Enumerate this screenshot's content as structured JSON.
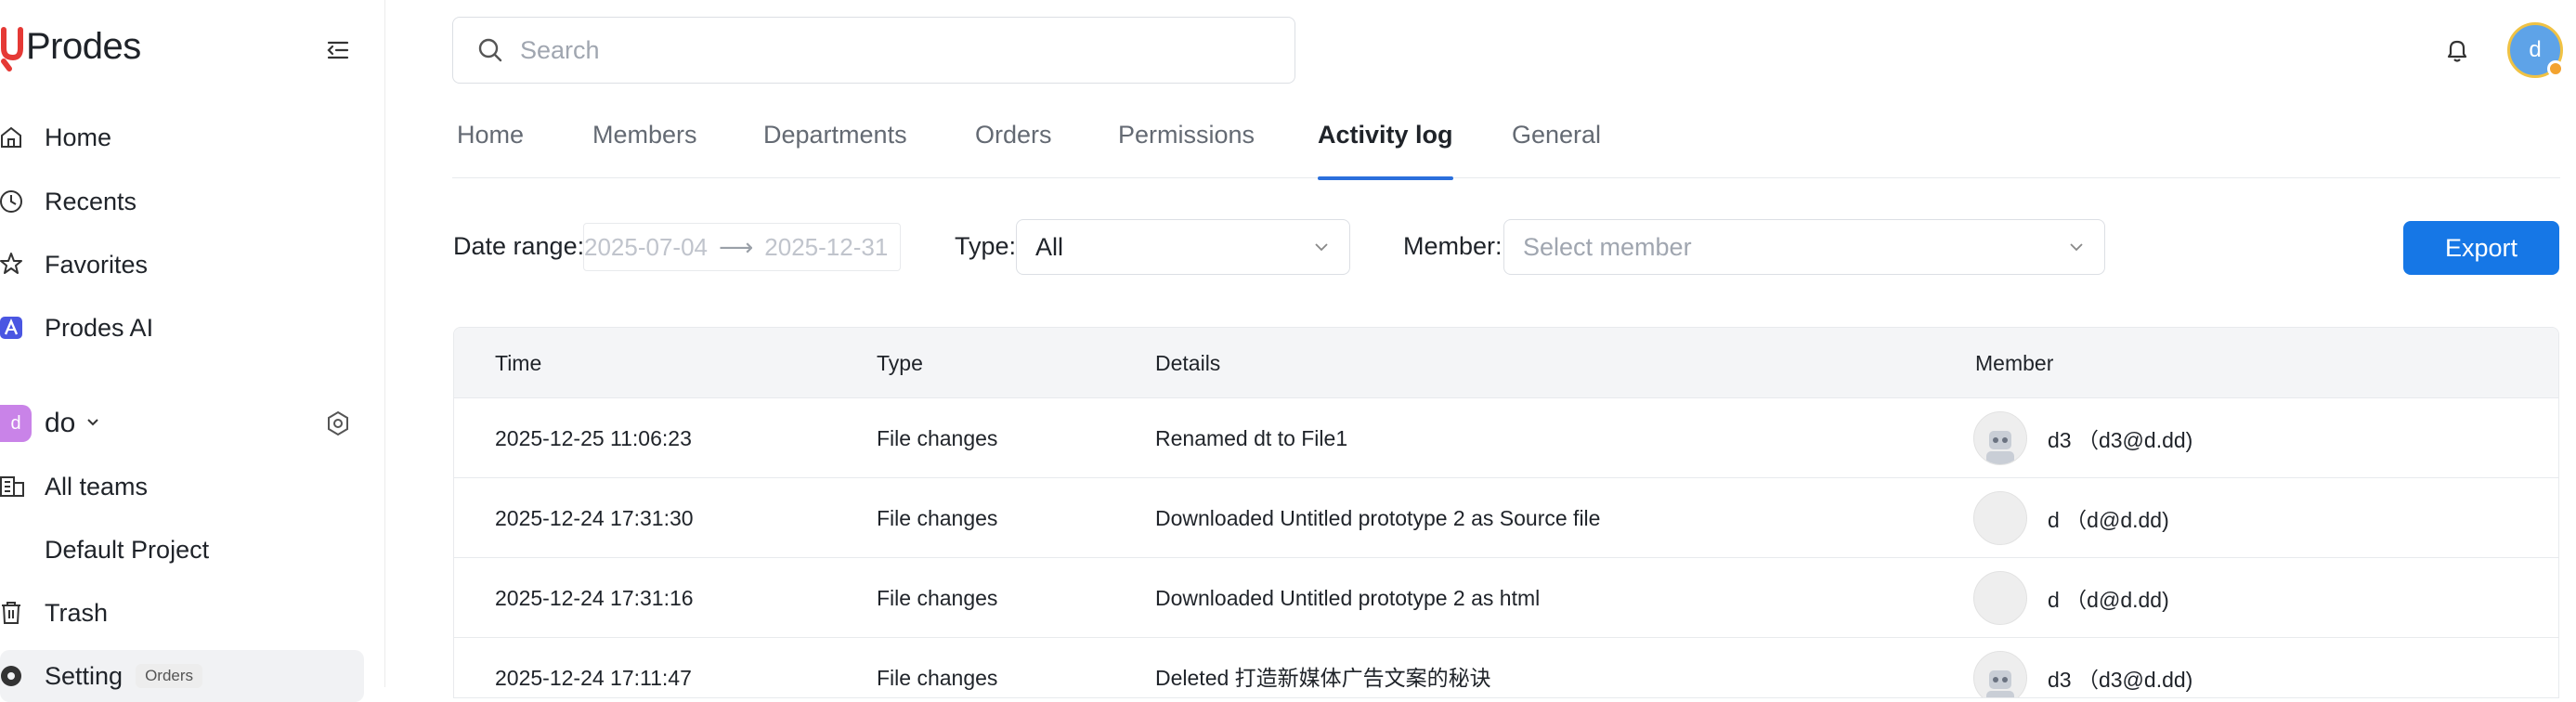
{
  "brand": {
    "name": "Prodes",
    "accent": "#e53935"
  },
  "sidebar": {
    "items": [
      {
        "label": "Home",
        "icon": "home-icon"
      },
      {
        "label": "Recents",
        "icon": "clock-icon"
      },
      {
        "label": "Favorites",
        "icon": "star-icon"
      },
      {
        "label": "Prodes AI",
        "icon": "ai-icon"
      }
    ],
    "team": {
      "initial": "d",
      "name": "do"
    },
    "team_items": [
      {
        "label": "All teams",
        "icon": "teams-icon"
      },
      {
        "label": "Default Project",
        "icon": ""
      },
      {
        "label": "Trash",
        "icon": "trash-icon"
      },
      {
        "label": "Setting",
        "icon": "settings-icon",
        "badge": "Orders"
      }
    ]
  },
  "search": {
    "placeholder": "Search"
  },
  "user": {
    "initial": "d"
  },
  "tabs": [
    "Home",
    "Members",
    "Departments",
    "Orders",
    "Permissions",
    "Activity log",
    "General"
  ],
  "active_tab": "Activity log",
  "filters": {
    "date_label": "Date range:",
    "date_start": "2025-07-04",
    "date_end": "2025-12-31",
    "type_label": "Type:",
    "type_value": "All",
    "member_label": "Member:",
    "member_placeholder": "Select member",
    "export_label": "Export"
  },
  "table": {
    "headers": [
      "Time",
      "Type",
      "Details",
      "Member"
    ],
    "rows": [
      {
        "time": "2025-12-25 11:06:23",
        "type": "File changes",
        "details": "Renamed dt to File1",
        "member": "d3 （d3@d.dd)",
        "avatar": "robot"
      },
      {
        "time": "2025-12-24 17:31:30",
        "type": "File changes",
        "details": "Downloaded Untitled prototype 2 as Source file",
        "member": "d （d@d.dd)",
        "avatar": "blank"
      },
      {
        "time": "2025-12-24 17:31:16",
        "type": "File changes",
        "details": "Downloaded Untitled prototype 2 as html",
        "member": "d （d@d.dd)",
        "avatar": "blank"
      },
      {
        "time": "2025-12-24 17:11:47",
        "type": "File changes",
        "details": "Deleted 打造新媒体广告文案的秘诀",
        "member": "d3 （d3@d.dd)",
        "avatar": "robot"
      }
    ]
  }
}
